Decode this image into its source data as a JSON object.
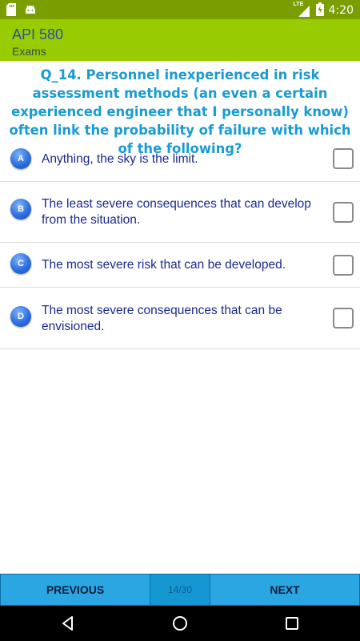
{
  "status_bar": {
    "time": "4:20",
    "network": "LTE",
    "icons": [
      "sd-card-icon",
      "android-icon",
      "signal-icon",
      "battery-icon"
    ]
  },
  "app_bar": {
    "title": "API 580",
    "subtitle": "Exams",
    "color": "#99cc00"
  },
  "question": {
    "text": "Q_14. Personnel inexperienced in risk assessment methods (an even a certain experienced engineer that I personally know) often link the probability of failure with which of the following?"
  },
  "options": [
    {
      "letter": "A",
      "text": "Anything, the sky is the limit.",
      "checked": false
    },
    {
      "letter": "B",
      "text": "The least severe consequences that can develop from the situation.",
      "checked": false
    },
    {
      "letter": "C",
      "text": "The most severe risk that can be developed.",
      "checked": false
    },
    {
      "letter": "D",
      "text": "The most severe consequences that can be envisioned.",
      "checked": false
    }
  ],
  "footer": {
    "previous_label": "PREVIOUS",
    "page_indicator": "14/30",
    "next_label": "NEXT"
  },
  "system_nav": {
    "icons": [
      "back-icon",
      "home-icon",
      "recents-icon"
    ]
  }
}
